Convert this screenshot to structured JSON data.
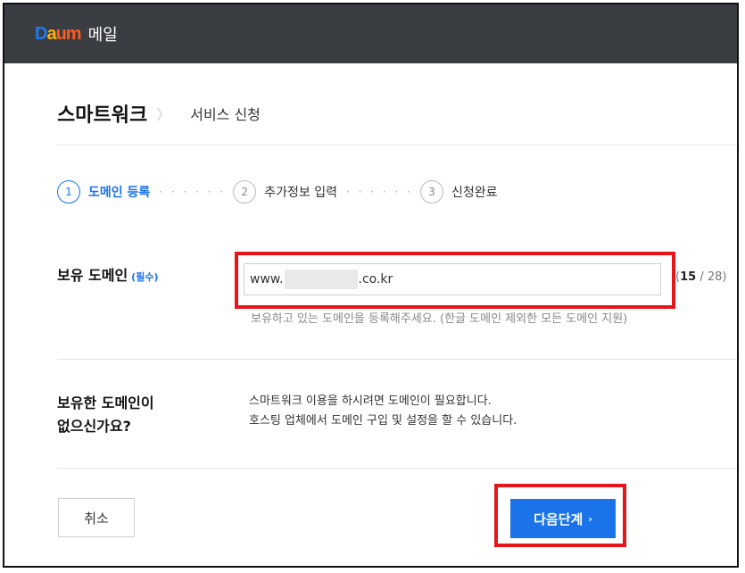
{
  "brand": {
    "logo_mark": [
      "D",
      "a",
      "u",
      "m"
    ],
    "service_name": "메일"
  },
  "header": {
    "title": "스마트워크",
    "separator": "〉",
    "breadcrumb": "서비스 신청"
  },
  "steps": [
    {
      "num": "1",
      "label": "도메인 등록",
      "active": true
    },
    {
      "num": "2",
      "label": "추가정보 입력",
      "active": false
    },
    {
      "num": "3",
      "label": "신청완료",
      "active": false
    }
  ],
  "step_separator": "· · · · · ·",
  "domain_section": {
    "label": "보유 도메인",
    "required_label": "(필수)",
    "value_prefix": "www.",
    "value_suffix": ".co.kr",
    "counter_current": "15",
    "counter_max": "/ 28)",
    "counter_open": "(",
    "help_text": "보유하고 있는 도메인을 등록해주세요. (한글 도메인 제외한 모든 도메인 지원)"
  },
  "no_domain_section": {
    "label_line1": "보유한 도메인이",
    "label_line2": "없으신가요?",
    "desc_line1": "스마트워크 이용을 하시려면 도메인이 필요합니다.",
    "desc_line2": "호스팅 업체에서 도메인 구입 및 설정을 할 수 있습니다."
  },
  "buttons": {
    "cancel": "취소",
    "next": "다음단계",
    "next_chevron": "›"
  },
  "colors": {
    "accent": "#1a73e8",
    "highlight": "#e8141c",
    "topbar": "#3a3d42"
  }
}
